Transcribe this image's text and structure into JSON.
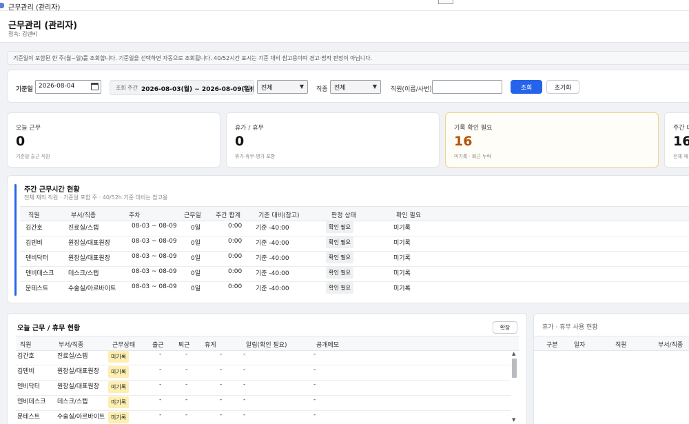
{
  "window": {
    "title": "근무관리 (관리자)"
  },
  "header": {
    "title": "근무관리 (관리자)",
    "user": "접속: 김덴비"
  },
  "notice": "기준일이 포함된 한 주(월~일)를 조회합니다. 기준일을 선택하면 자동으로 조회됩니다. 40/52시간 표시는 기준 대비 참고용이며 경고·법적 판정이 아닙니다.",
  "filter": {
    "date_label": "기준일",
    "date_value": "2026-08-04",
    "week_label": "조회 주간",
    "week_value": "2026-08-03(월) ~ 2026-08-09(일)",
    "dept_label": "부서",
    "dept_value": "전체",
    "job_label": "직종",
    "job_value": "전체",
    "staff_label": "직원(이름/사번)",
    "staff_value": "",
    "search_button": "조회",
    "reset_button": "초기화"
  },
  "stats": [
    {
      "label": "오늘 근무",
      "value": "0",
      "sub": "기준일 출근 직원"
    },
    {
      "label": "휴가 / 휴무",
      "value": "0",
      "sub": "휴가·휴무·병가 포함"
    },
    {
      "label": "기록 확인 필요",
      "value": "16",
      "sub": "미기록 · 퇴근 누락"
    },
    {
      "label": "주간 대",
      "value": "16",
      "sub": "전체 재"
    }
  ],
  "weekly": {
    "title": "주간 근무시간 현황",
    "subtitle": "전체 재직 직원 · 기준일 포함 주 · 40/52h 기준 대비는 참고용",
    "columns": [
      "직원",
      "부서/직종",
      "주차",
      "근무일",
      "주간 합계",
      "기준 대비(참고)",
      "판정 상태",
      "확인 필요"
    ],
    "rows": [
      {
        "name": "김간호",
        "dept": "진료실/스텝",
        "week": "08-03 ~ 08-09",
        "days": "0일",
        "total": "0:00",
        "diff": "기준 -40:00",
        "status": "확인 필요",
        "check": "미기록"
      },
      {
        "name": "김덴비",
        "dept": "원장실/대표원장",
        "week": "08-03 ~ 08-09",
        "days": "0일",
        "total": "0:00",
        "diff": "기준 -40:00",
        "status": "확인 필요",
        "check": "미기록"
      },
      {
        "name": "덴비닥터",
        "dept": "원장실/대표원장",
        "week": "08-03 ~ 08-09",
        "days": "0일",
        "total": "0:00",
        "diff": "기준 -40:00",
        "status": "확인 필요",
        "check": "미기록"
      },
      {
        "name": "덴비데스크",
        "dept": "데스크/스텝",
        "week": "08-03 ~ 08-09",
        "days": "0일",
        "total": "0:00",
        "diff": "기준 -40:00",
        "status": "확인 필요",
        "check": "미기록"
      },
      {
        "name": "문테스트",
        "dept": "수술실/아르바이트",
        "week": "08-03 ~ 08-09",
        "days": "0일",
        "total": "0:00",
        "diff": "기준 -40:00",
        "status": "확인 필요",
        "check": "미기록"
      }
    ]
  },
  "today": {
    "title": "오늘 근무 / 휴무 현황",
    "expand_button": "확장",
    "columns": [
      "직원",
      "부서/직종",
      "근무상태",
      "출근",
      "퇴근",
      "휴게",
      "알림(확인 필요)",
      "공개메모"
    ],
    "rows": [
      {
        "name": "김간호",
        "dept": "진료실/스텝",
        "status": "미기록",
        "in": "-",
        "out": "-",
        "rest": "-",
        "alert": "-",
        "memo": "-"
      },
      {
        "name": "김덴비",
        "dept": "원장실/대표원장",
        "status": "미기록",
        "in": "-",
        "out": "-",
        "rest": "-",
        "alert": "-",
        "memo": "-"
      },
      {
        "name": "덴비닥터",
        "dept": "원장실/대표원장",
        "status": "미기록",
        "in": "-",
        "out": "-",
        "rest": "-",
        "alert": "-",
        "memo": "-"
      },
      {
        "name": "덴비데스크",
        "dept": "데스크/스텝",
        "status": "미기록",
        "in": "-",
        "out": "-",
        "rest": "-",
        "alert": "-",
        "memo": "-"
      },
      {
        "name": "문테스트",
        "dept": "수술실/아르바이트",
        "status": "미기록",
        "in": "-",
        "out": "-",
        "rest": "-",
        "alert": "-",
        "memo": "-"
      }
    ]
  },
  "leave": {
    "title": "휴가 · 휴무 사용 현황",
    "columns": [
      "구분",
      "일자",
      "직원",
      "부서/직종"
    ]
  },
  "icons": {
    "calendar": "calendar-icon",
    "dropdown": "chevron-down-icon",
    "scroll_up": "scroll-up-icon",
    "scroll_down": "scroll-down-icon"
  },
  "colors": {
    "accent": "#2563eb",
    "warning_text": "#b45309",
    "status_chip": "#fdefb2"
  }
}
